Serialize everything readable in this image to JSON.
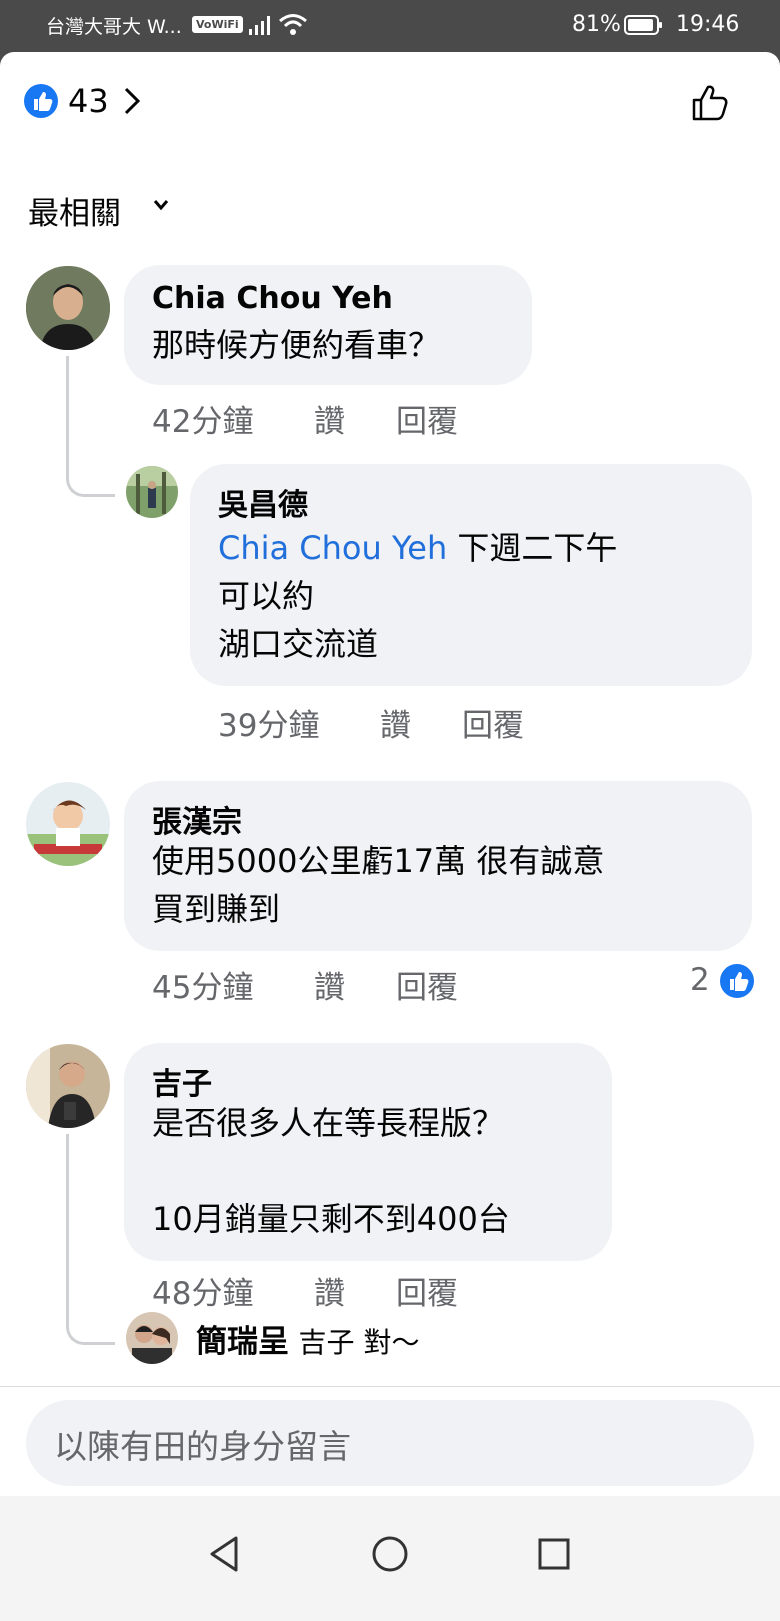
{
  "status_bar": {
    "carrier": "台灣大哥大 W...",
    "vowifi": "VoWiFi",
    "battery": "81%",
    "time": "19:46"
  },
  "header": {
    "like_count": "43",
    "icons": [
      "like-badge-icon",
      "chevron-right-icon",
      "thumbs-up-outline-icon"
    ]
  },
  "sort": {
    "label": "最相關"
  },
  "comments": [
    {
      "name": "Chia Chou Yeh",
      "text": [
        "那時候方便約看車？"
      ],
      "time": "42分鐘",
      "like": "讚",
      "reply": "回覆",
      "replies": [
        {
          "name": "吳昌德",
          "mention": "Chia Chou Yeh",
          "text_after_mention": " 下週二下午",
          "text": [
            "可以約",
            "湖口交流道"
          ],
          "time": "39分鐘",
          "like": "讚",
          "reply": "回覆"
        }
      ]
    },
    {
      "name": "張漢宗",
      "text": [
        "使用5000公里虧17萬 很有誠意",
        "買到賺到"
      ],
      "time": "45分鐘",
      "like": "讚",
      "reply": "回覆",
      "reactions": "2"
    },
    {
      "name": "吉子",
      "text": [
        "是否很多人在等長程版？",
        "",
        "10月銷量只剩不到400台"
      ],
      "time": "48分鐘",
      "like": "讚",
      "reply": "回覆",
      "reply_preview": {
        "name": "簡瑞呈",
        "mention": "吉子",
        "text": " 對～"
      }
    }
  ],
  "composer": {
    "placeholder": "以陳有田的身分留言"
  },
  "nav": {
    "icons": [
      "back-triangle-icon",
      "home-circle-icon",
      "recents-square-icon"
    ]
  },
  "colors": {
    "accent": "#1877f2",
    "mention": "#216fdb",
    "bubble": "#f0f2f5",
    "meta": "#65676b"
  }
}
